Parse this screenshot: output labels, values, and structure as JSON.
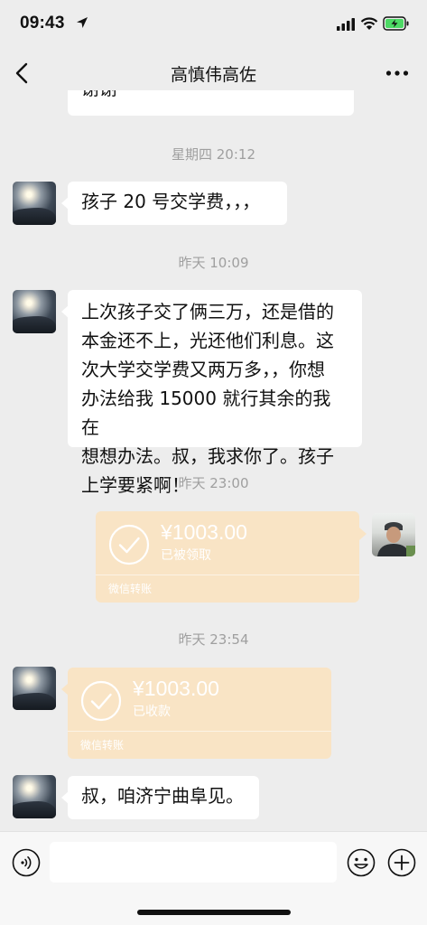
{
  "status_bar": {
    "time": "09:43"
  },
  "nav": {
    "title": "高慎伟高佐"
  },
  "messages": {
    "m0_text": "谢谢",
    "ts1": "星期四 20:12",
    "m1_text": "孩子 20 号交学费，，，",
    "ts2": "昨天 10:09",
    "m2_lines": [
      "上次孩子交了俩三万，还是借的",
      "本金还不上，光还他们利息。这",
      "次大学交学费又两万多，，你想",
      "办法给我 15000 就行其余的我在",
      "想想办法。叔，我求你了。孩子",
      "上学要紧啊！"
    ],
    "ts3": "昨天 23:00",
    "t1": {
      "amount": "¥1003.00",
      "status": "已被领取",
      "footer": "微信转账"
    },
    "ts4": "昨天 23:54",
    "t2": {
      "amount": "¥1003.00",
      "status": "已收款",
      "footer": "微信转账"
    },
    "m3_text": "叔，咱济宁曲阜见。"
  },
  "colors": {
    "transfer_bg": "#f9e4c5",
    "chat_bg": "#ededed",
    "timestamp": "#9f9f9f"
  }
}
